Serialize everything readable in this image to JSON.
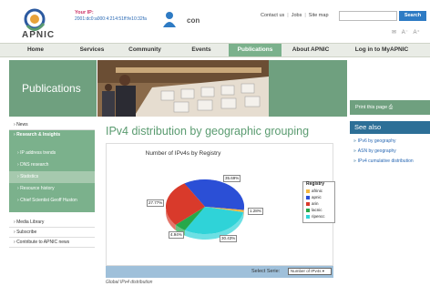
{
  "header": {
    "logo_text": "APNIC",
    "ip_label": "Your IP:",
    "ip_value": "2001:dc0:a000:4:214:51ff:fe10:32fa",
    "connect_text": "con",
    "links": [
      "Contact us",
      "Jobs",
      "Site map"
    ],
    "search_placeholder": "",
    "search_label": "Search",
    "tools": [
      "✉",
      "A⁻",
      "A⁺"
    ]
  },
  "nav": {
    "items": [
      "Home",
      "Services",
      "Community",
      "Events",
      "Publications",
      "About APNIC",
      "Log in to MyAPNIC"
    ],
    "active": "Publications"
  },
  "banner": {
    "title": "Publications"
  },
  "print_label": "Print this page",
  "see_also": {
    "title": "See also",
    "links": [
      "IPv6 by geography",
      "ASN by geography",
      "IPv4 cumulative distribution"
    ]
  },
  "sidebar": {
    "news": "News",
    "section": "Research & Insights",
    "subitems": [
      "IP address trends",
      "DNS research",
      "Statistics",
      "Resource history",
      "Chief Scientist Geoff Huston"
    ],
    "active_sub": "Statistics",
    "after": [
      "Media Library",
      "Subscribe",
      "Contribute to APNIC news"
    ]
  },
  "main": {
    "title": "IPv4 distribution by geographic grouping",
    "caption": "Global IPv4 distribution"
  },
  "serie": {
    "label": "Select Serie:",
    "value": "Number of IPv4s"
  },
  "chart_data": {
    "type": "pie",
    "title": "Number of IPv4s by Registry",
    "legend_title": "Registry",
    "legend_position": "right",
    "categories": [
      "afrinic",
      "apnic",
      "arin",
      "lacnic",
      "ripencc"
    ],
    "values": [
      1.28,
      35.69,
      27.77,
      4.94,
      30.43
    ],
    "percent_labels": [
      "1.28%",
      "35.69%",
      "27.77%",
      "4.94%",
      "30.43%"
    ],
    "colors": [
      "#f5b840",
      "#2b4fd6",
      "#d93a2b",
      "#27a84a",
      "#2fd3d8"
    ]
  }
}
